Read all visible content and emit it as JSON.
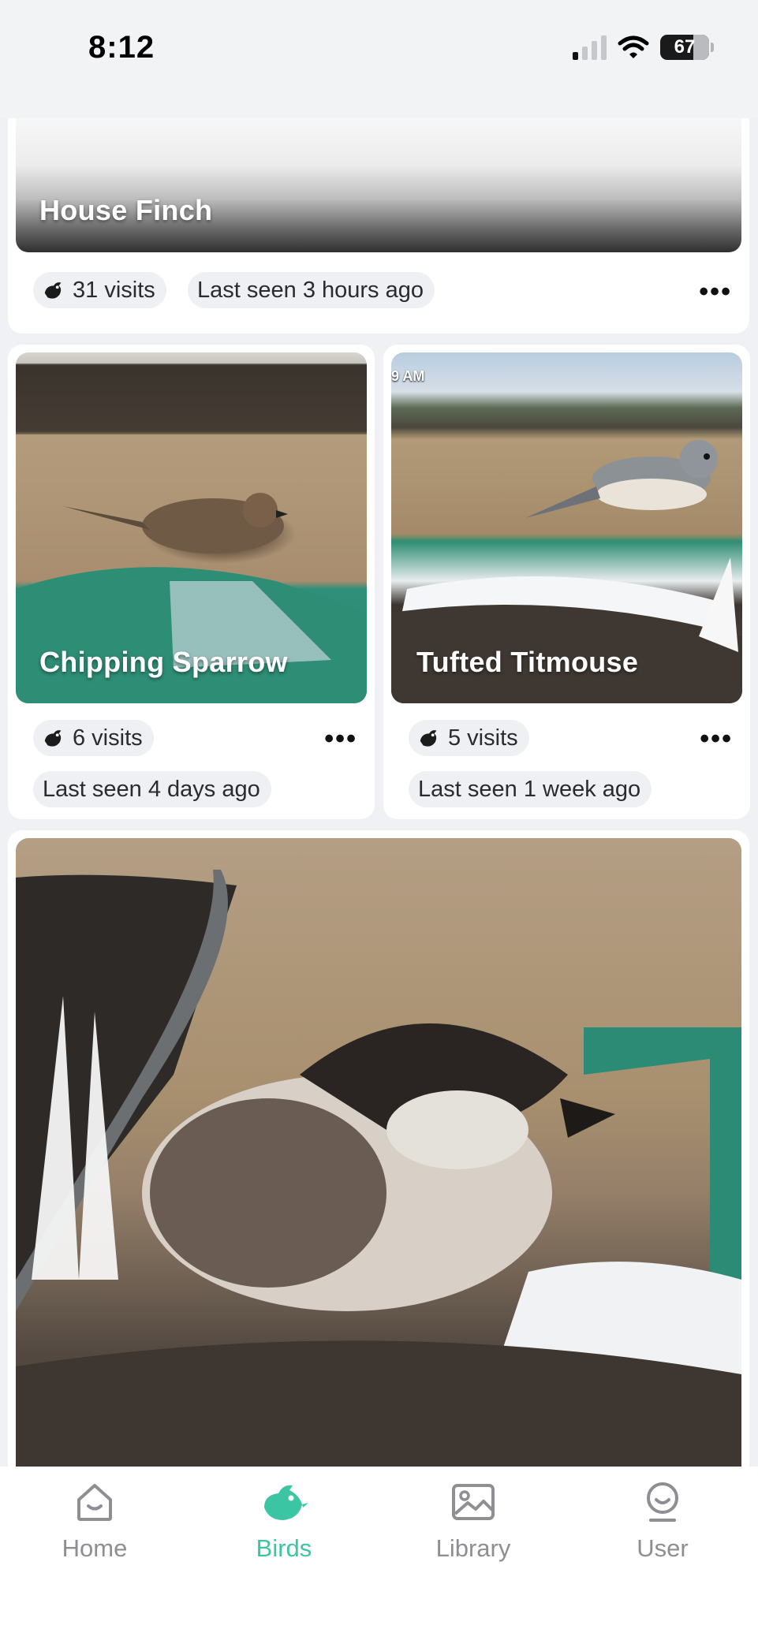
{
  "status_bar": {
    "time": "8:12",
    "battery": "67"
  },
  "cards": {
    "house_finch": {
      "name": "House Finch",
      "visits": "31 visits",
      "last_seen": "Last seen 3 hours ago",
      "more": "•••"
    },
    "chipping_sparrow": {
      "name": "Chipping Sparrow",
      "visits": "6 visits",
      "last_seen": "Last seen 4 days ago",
      "more": "•••"
    },
    "tufted_titmouse": {
      "name": "Tufted Titmouse",
      "timestamp_fragment": "9 AM",
      "visits": "5 visits",
      "last_seen": "Last seen 1 week ago",
      "more": "•••"
    }
  },
  "tab_bar": {
    "tabs": [
      {
        "label": "Home",
        "icon": "home-icon",
        "active": false
      },
      {
        "label": "Birds",
        "icon": "bird-icon",
        "active": true
      },
      {
        "label": "Library",
        "icon": "image-icon",
        "active": false
      },
      {
        "label": "User",
        "icon": "user-icon",
        "active": false
      }
    ]
  },
  "colors": {
    "accent": "#3cc5a3",
    "inactive": "#8e8e93",
    "pill_bg": "#eef0f3",
    "page_bg": "#eff1f4"
  }
}
